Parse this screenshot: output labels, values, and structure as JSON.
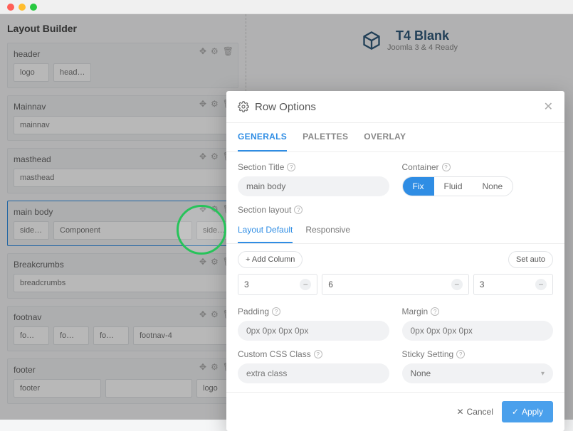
{
  "brand": {
    "name": "T4 Blank",
    "tagline": "Joomla 3 & 4 Ready"
  },
  "builder": {
    "title": "Layout Builder",
    "sections": [
      {
        "name": "header",
        "blocks": [
          "logo",
          "head…"
        ],
        "selected": false
      },
      {
        "name": "Mainnav",
        "blocks": [
          "mainnav"
        ],
        "selected": false
      },
      {
        "name": "masthead",
        "blocks": [
          "masthead"
        ],
        "selected": false
      },
      {
        "name": "main body",
        "blocks": [
          "side…",
          "Component",
          "side…"
        ],
        "selected": true
      },
      {
        "name": "Breakcrumbs",
        "blocks": [
          "breadcrumbs"
        ],
        "selected": false
      },
      {
        "name": "footnav",
        "blocks": [
          "fo…",
          "fo…",
          "fo…",
          "footnav-4"
        ],
        "selected": false
      },
      {
        "name": "footer",
        "blocks": [
          "footer",
          "",
          "logo"
        ],
        "selected": false
      }
    ]
  },
  "modal": {
    "title": "Row Options",
    "tabs": [
      "GENERALS",
      "PALETTES",
      "OVERLAY"
    ],
    "activeTab": "GENERALS",
    "sectionTitleLabel": "Section Title",
    "sectionTitle": "main body",
    "containerLabel": "Container",
    "containerOptions": [
      "Fix",
      "Fluid",
      "None"
    ],
    "containerActive": "Fix",
    "sectionLayoutLabel": "Section layout",
    "subtabs": [
      "Layout Default",
      "Responsive"
    ],
    "subtabActive": "Layout Default",
    "addColumn": "+ Add Column",
    "setAuto": "Set auto",
    "columns": [
      "3",
      "6",
      "3"
    ],
    "paddingLabel": "Padding",
    "paddingPlaceholder": "0px 0px 0px 0px",
    "marginLabel": "Margin",
    "marginPlaceholder": "0px 0px 0px 0px",
    "cssLabel": "Custom CSS Class",
    "cssPlaceholder": "extra class",
    "stickyLabel": "Sticky Setting",
    "stickyValue": "None",
    "cancel": "Cancel",
    "apply": "Apply"
  }
}
